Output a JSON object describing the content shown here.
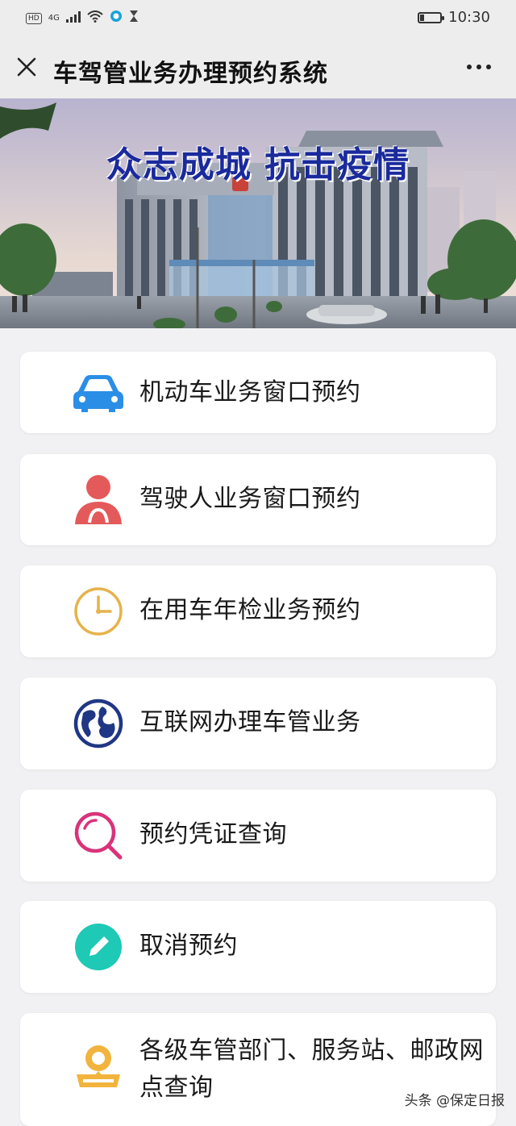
{
  "status_bar": {
    "hd": "HD",
    "network": "4G",
    "time": "10:30",
    "battery_level": 0.2
  },
  "header": {
    "title": "车驾管业务办理预约系统"
  },
  "banner": {
    "slogan": "众志成城 抗击疫情"
  },
  "menu": {
    "items": [
      {
        "label": "机动车业务窗口预约",
        "icon": "car-icon",
        "color": "#2b8ee6"
      },
      {
        "label": "驾驶人业务窗口预约",
        "icon": "person-icon",
        "color": "#e45a5a"
      },
      {
        "label": "在用车年检业务预约",
        "icon": "clock-icon",
        "color": "#e6b24a"
      },
      {
        "label": "互联网办理车管业务",
        "icon": "globe-icon",
        "color": "#1f3784"
      },
      {
        "label": "预约凭证查询",
        "icon": "search-icon",
        "color": "#d9337a"
      },
      {
        "label": "取消预约",
        "icon": "pencil-icon",
        "color": "#1ec9b6"
      },
      {
        "label": "各级车管部门、服务站、邮政网点查询",
        "icon": "location-icon",
        "color": "#f2b43d"
      }
    ]
  },
  "watermark": "头条 @保定日报"
}
